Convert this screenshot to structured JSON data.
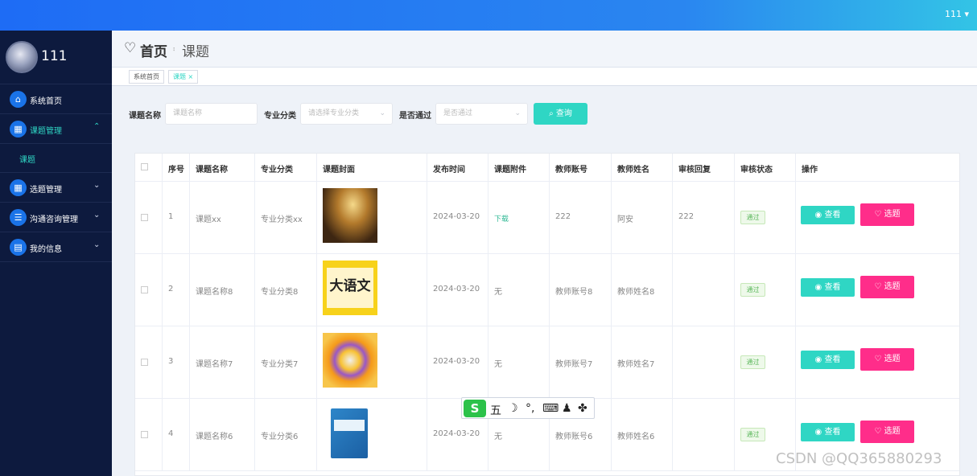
{
  "topbar": {
    "user": "111 ▾"
  },
  "sidebar": {
    "name": "111",
    "items": [
      {
        "label": "系统首页",
        "icon": "home-icon",
        "glyph": "⌂",
        "chev": ""
      },
      {
        "label": "课题管理",
        "icon": "grid-icon",
        "glyph": "▦",
        "chev": "⌃"
      },
      {
        "label": "选题管理",
        "icon": "grid-icon",
        "glyph": "▦",
        "chev": "⌄"
      },
      {
        "label": "沟通咨询管理",
        "icon": "list-icon",
        "glyph": "☰",
        "chev": "⌄"
      },
      {
        "label": "我的信息",
        "icon": "card-icon",
        "glyph": "▤",
        "chev": "⌄"
      }
    ],
    "sub": "课题"
  },
  "breadcrumb": {
    "heart": "♡",
    "home": "首页",
    "sep": "⠆",
    "current": "课题"
  },
  "tabs": [
    "系统首页",
    "课题 ×"
  ],
  "search": {
    "name_label": "课题名称",
    "name_placeholder": "课题名称",
    "major_label": "专业分类",
    "major_placeholder": "请选择专业分类",
    "pass_label": "是否通过",
    "pass_placeholder": "是否通过",
    "button": "⌕ 查询"
  },
  "table": {
    "headers": [
      "序号",
      "课题名称",
      "专业分类",
      "课题封面",
      "发布时间",
      "课题附件",
      "教师账号",
      "教师姓名",
      "审核回复",
      "审核状态",
      "操作"
    ],
    "rows": [
      {
        "no": "1",
        "name": "课题xx",
        "major": "专业分类xx",
        "date": "2024-03-20",
        "attach": "下载",
        "acct": "222",
        "teacher": "阿安",
        "reply": "222",
        "status": "通过"
      },
      {
        "no": "2",
        "name": "课题名称8",
        "major": "专业分类8",
        "date": "2024-03-20",
        "attach": "无",
        "acct": "教师账号8",
        "teacher": "教师姓名8",
        "reply": "",
        "status": "通过"
      },
      {
        "no": "3",
        "name": "课题名称7",
        "major": "专业分类7",
        "date": "2024-03-20",
        "attach": "无",
        "acct": "教师账号7",
        "teacher": "教师姓名7",
        "reply": "",
        "status": "通过"
      },
      {
        "no": "4",
        "name": "课题名称6",
        "major": "专业分类6",
        "date": "2024-03-20",
        "attach": "无",
        "acct": "教师账号6",
        "teacher": "教师姓名6",
        "reply": "",
        "status": "通过"
      }
    ],
    "view_label": "◉ 查看",
    "pick_label": "♡ 选题",
    "cover2_text": "大语文"
  },
  "ime": {
    "logo": "S",
    "keys": [
      "五",
      "☽",
      "°,",
      "⌨",
      "♟",
      "✤"
    ]
  },
  "watermark": "CSDN @QQ365880293"
}
